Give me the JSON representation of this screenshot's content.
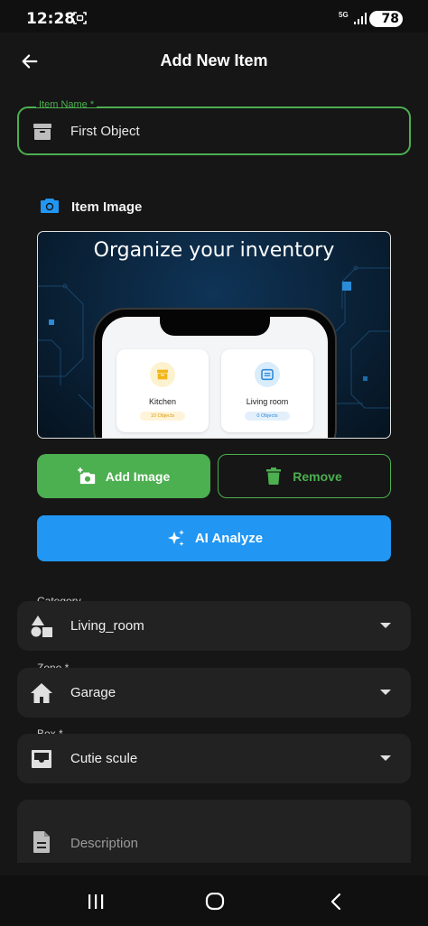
{
  "status_bar": {
    "time": "12:28",
    "network": "5G",
    "battery": "78"
  },
  "header": {
    "title": "Add New Item",
    "back_icon": "arrow-left-icon"
  },
  "item_name": {
    "label": "Item Name *",
    "value": "First Object",
    "icon": "archive-box-icon",
    "focus_color": "#4caf50"
  },
  "image_section": {
    "label": "Item Image",
    "icon": "camera-icon",
    "icon_color": "#2196f3",
    "preview": {
      "heading": "Organize your inventory",
      "cards": [
        {
          "name": "Kitchen",
          "count": "10 Objects"
        },
        {
          "name": "Living room",
          "count": "0 Objects"
        }
      ]
    }
  },
  "actions": {
    "add_image": "Add Image",
    "remove": "Remove",
    "ai_analyze": "AI Analyze",
    "primary_color": "#4caf50",
    "ai_color": "#2196f3"
  },
  "fields": {
    "category": {
      "label": "Category",
      "value": "Living_room",
      "icon": "shapes-icon"
    },
    "zone": {
      "label": "Zone *",
      "value": "Garage",
      "icon": "home-icon"
    },
    "box": {
      "label": "Box *",
      "value": "Cutie scule",
      "icon": "inbox-icon"
    },
    "description": {
      "placeholder": "Description",
      "icon": "document-icon"
    }
  },
  "nav": {
    "recents": "recents-icon",
    "home": "home-circle-icon",
    "back": "back-chevron-icon"
  }
}
